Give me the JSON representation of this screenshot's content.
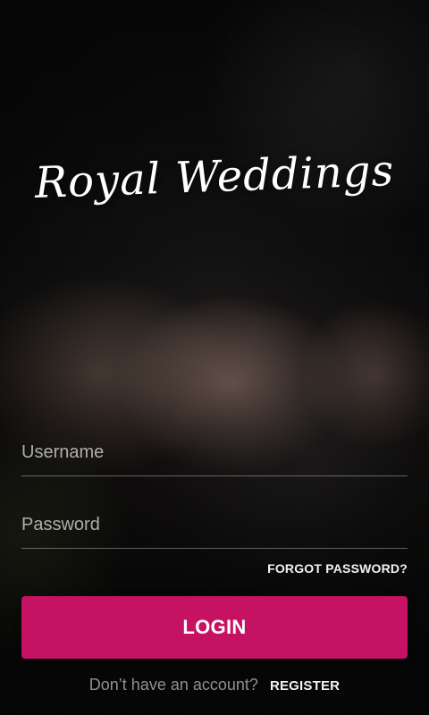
{
  "app": {
    "logo_text": "Royal Weddings"
  },
  "form": {
    "username": {
      "placeholder": "Username",
      "value": ""
    },
    "password": {
      "placeholder": "Password",
      "value": ""
    },
    "forgot_label": "FORGOT PASSWORD?",
    "login_label": "LOGIN"
  },
  "footer": {
    "prompt": "Don’t have an account?",
    "register_label": "REGISTER"
  },
  "colors": {
    "primary_button": "#c51263"
  }
}
